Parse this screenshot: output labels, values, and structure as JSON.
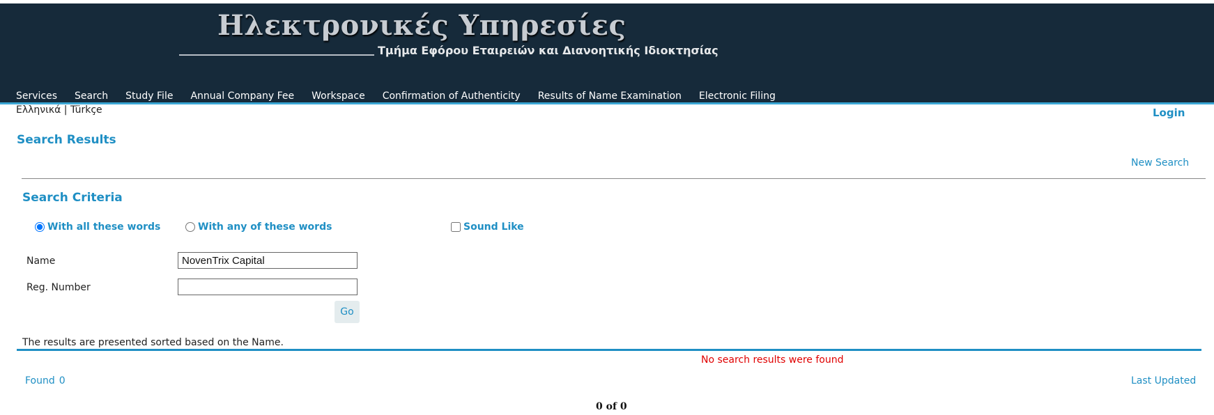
{
  "header": {
    "title": "Ηλεκτρονικές Υπηρεσίες",
    "subtitle": "Τμήμα Εφόρου Εταιρειών και Διανοητικής Ιδιοκτησίας"
  },
  "nav": {
    "items": [
      "Services",
      "Search",
      "Study File",
      "Annual Company Fee",
      "Workspace",
      "Confirmation of Authenticity",
      "Results of Name Examination",
      "Electronic Filing"
    ]
  },
  "lang": {
    "greek": "Ελληνικά",
    "separator": "|",
    "turkish": "Türkçe"
  },
  "login_label": "Login",
  "results_heading": "Search Results",
  "new_search_label": "New Search",
  "criteria": {
    "heading": "Search Criteria",
    "options": {
      "all_words": "With all these words",
      "any_words": "With any of these words",
      "sound_like": "Sound Like"
    },
    "name_label": "Name",
    "name_value": "NovenTrix Capital",
    "reg_label": "Reg. Number",
    "reg_value": "",
    "go_label": "Go"
  },
  "sorted_note": "The results are presented sorted based on the Name.",
  "no_results": "No search results were found",
  "found": {
    "label": "Found",
    "count": "0"
  },
  "last_updated_label": "Last Updated",
  "pager": "0 of 0",
  "colors": {
    "header_bg": "#162a3a",
    "accent": "#1f8fc4",
    "error": "#e00000"
  }
}
